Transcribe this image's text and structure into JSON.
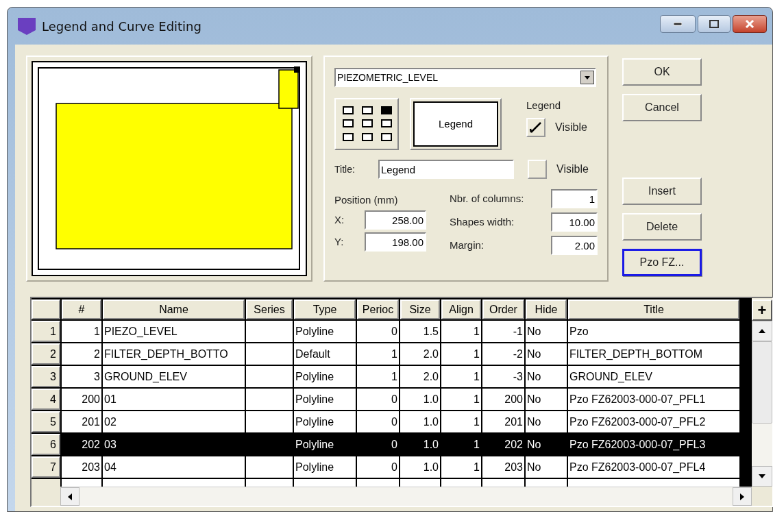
{
  "window": {
    "title": "Legend and Curve Editing"
  },
  "layer_dropdown": {
    "value": "PIEZOMETRIC_LEVEL"
  },
  "anchor_positions": [
    {
      "selected": false
    },
    {
      "selected": false
    },
    {
      "selected": true
    },
    {
      "selected": false
    },
    {
      "selected": false
    },
    {
      "selected": false
    },
    {
      "selected": false
    },
    {
      "selected": false
    },
    {
      "selected": false
    }
  ],
  "legend_preview": {
    "label": "Legend"
  },
  "legend_group": {
    "label": "Legend",
    "visible_label": "Visible",
    "checked": true
  },
  "title_row": {
    "label": "Title:",
    "value": "Legend",
    "visible_label": "Visible",
    "checked": false
  },
  "position": {
    "label": "Position (mm)",
    "x_label": "X:",
    "x_value": "258.00",
    "y_label": "Y:",
    "y_value": "198.00"
  },
  "settings": [
    {
      "label": "Nbr. of columns:",
      "value": "1"
    },
    {
      "label": "Shapes width:",
      "value": "10.00"
    },
    {
      "label": "Margin:",
      "value": "2.00"
    }
  ],
  "buttons": [
    {
      "label": "OK",
      "focused": false
    },
    {
      "label": "Cancel",
      "focused": false
    },
    {
      "label": "Insert",
      "focused": false
    },
    {
      "label": "Delete",
      "focused": false
    },
    {
      "label": "Pzo FZ...",
      "focused": true
    }
  ],
  "table": {
    "columns": [
      "#",
      "Name",
      "Series",
      "Type",
      "Perioc",
      "Size",
      "Align",
      "Order",
      "Hide",
      "Title"
    ],
    "add_column_button": "+",
    "rows": [
      {
        "row_number": "1",
        "cells": [
          "1",
          "PIEZO_LEVEL",
          "",
          "Polyline",
          "0",
          "1.5",
          "1",
          "-1",
          "No",
          "Pzo"
        ],
        "selected": false
      },
      {
        "row_number": "2",
        "cells": [
          "2",
          "FILTER_DEPTH_BOTTO",
          "",
          "Default",
          "1",
          "2.0",
          "1",
          "-2",
          "No",
          "FILTER_DEPTH_BOTTOM"
        ],
        "selected": false
      },
      {
        "row_number": "3",
        "cells": [
          "3",
          "GROUND_ELEV",
          "",
          "Polyline",
          "1",
          "2.0",
          "1",
          "-3",
          "No",
          "GROUND_ELEV"
        ],
        "selected": false
      },
      {
        "row_number": "4",
        "cells": [
          "200",
          "01",
          "",
          "Polyline",
          "0",
          "1.0",
          "1",
          "200",
          "No",
          "Pzo FZ62003-000-07_PFL1"
        ],
        "selected": false
      },
      {
        "row_number": "5",
        "cells": [
          "201",
          "02",
          "",
          "Polyline",
          "0",
          "1.0",
          "1",
          "201",
          "No",
          "Pzo FZ62003-000-07_PFL2"
        ],
        "selected": false
      },
      {
        "row_number": "6",
        "cells": [
          "202",
          "03",
          "",
          "Polyline",
          "0",
          "1.0",
          "1",
          "202",
          "No",
          "Pzo FZ62003-000-07_PFL3"
        ],
        "selected": true
      },
      {
        "row_number": "7",
        "cells": [
          "203",
          "04",
          "",
          "Polyline",
          "0",
          "1.0",
          "1",
          "203",
          "No",
          "Pzo FZ62003-000-07_PFL4"
        ],
        "selected": false
      }
    ]
  }
}
